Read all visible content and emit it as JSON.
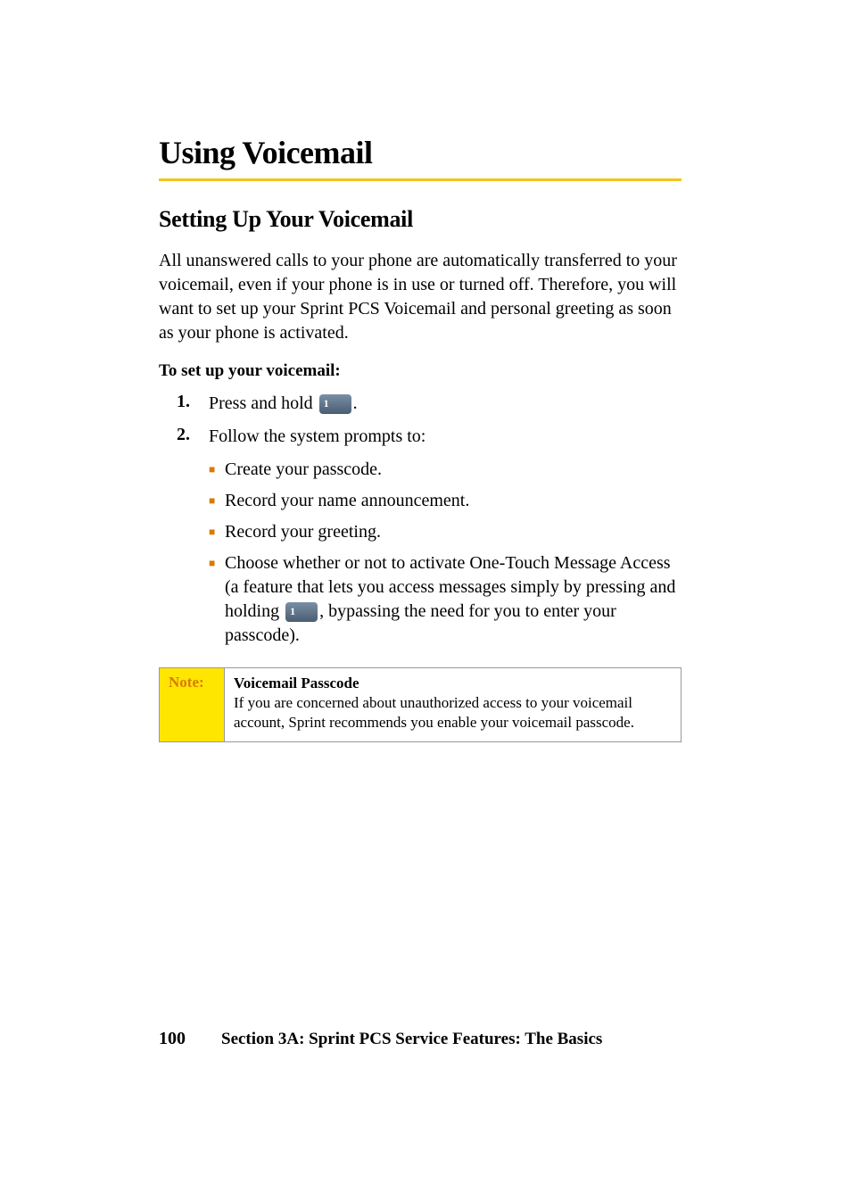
{
  "heading": "Using Voicemail",
  "subheading": "Setting Up Your Voicemail",
  "intro_para": "All unanswered calls to your phone are automatically transferred to your voicemail, even if your phone is in use or turned off. Therefore, you will want to set up your Sprint PCS Voicemail and personal greeting as soon as your phone is activated.",
  "setup_label": "To set up your voicemail:",
  "steps": {
    "one_num": "1.",
    "one_text_before": "Press and hold ",
    "one_text_after": ".",
    "two_num": "2.",
    "two_text": "Follow the system prompts to:"
  },
  "bullets": {
    "b1": "Create your passcode.",
    "b2": "Record your name announcement.",
    "b3": "Record your greeting.",
    "b4_before": "Choose whether or not to activate One-Touch Message Access (a feature that lets you access messages simply by pressing and holding ",
    "b4_after": ", bypassing the need for you to enter your passcode)."
  },
  "note": {
    "label": "Note:",
    "title": "Voicemail Passcode",
    "body": "If you are concerned about unauthorized access to your voicemail account, Sprint recommends you enable your voicemail passcode."
  },
  "footer": {
    "page_num": "100",
    "section": "Section 3A: Sprint PCS Service Features: The Basics"
  }
}
